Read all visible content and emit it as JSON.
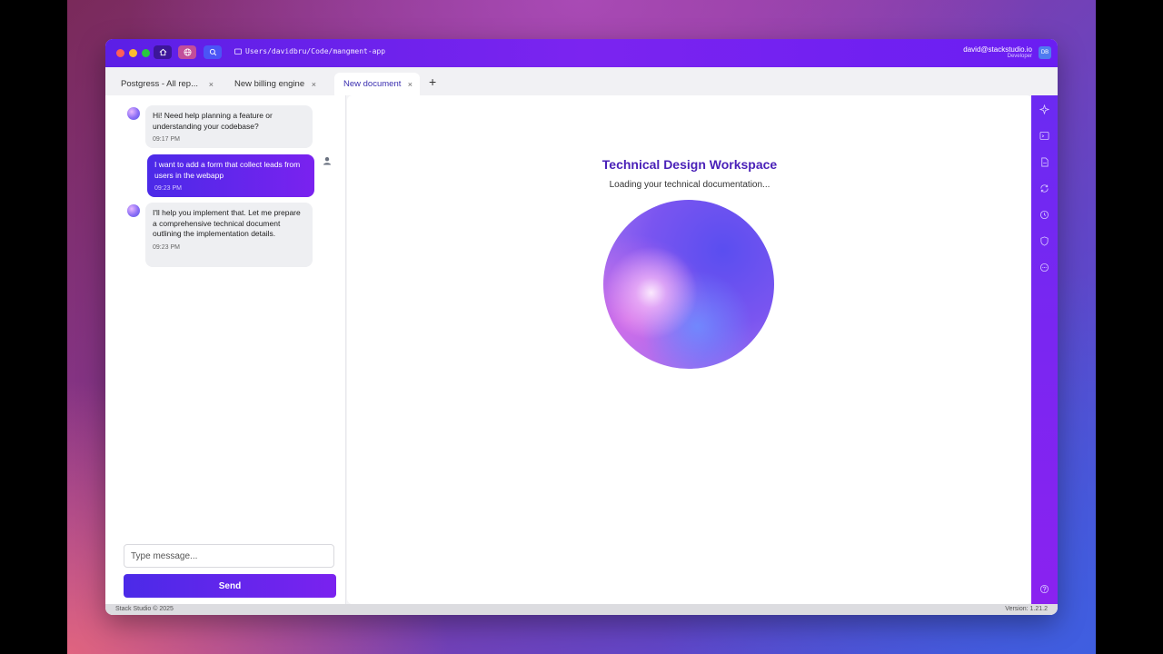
{
  "titlebar": {
    "path": "Users/davidbru/Code/mangment-app",
    "user_email": "david@stackstudio.io",
    "user_role": "Developer",
    "avatar_initials": "DB"
  },
  "tabs": [
    {
      "label": "Postgress - All rep...",
      "close": "×"
    },
    {
      "label": "New billing engine",
      "close": "×"
    },
    {
      "label": "New document",
      "close": "×"
    }
  ],
  "tab_add": "+",
  "chat": {
    "messages": [
      {
        "from": "bot",
        "text": "Hi! Need help planning a feature or understanding your codebase?",
        "time": "09:17 PM"
      },
      {
        "from": "user",
        "text": "I want to add a form that collect leads from users in the webapp",
        "time": "09:23 PM"
      },
      {
        "from": "bot",
        "text": "I'll help you implement that. Let me prepare a comprehensive technical document outlining the implementation details.",
        "time": "09:23 PM"
      }
    ],
    "input_placeholder": "Type message...",
    "send_label": "Send"
  },
  "document": {
    "title": "Technical Design Workspace",
    "subtitle": "Loading your technical documentation..."
  },
  "status": {
    "left": "Stack Studio © 2025",
    "right": "Version: 1.21.2"
  },
  "colors": {
    "accent": "#6b24f0",
    "title": "#4a21b8"
  },
  "icons": {
    "rightbar": [
      "sparkle-icon",
      "terminal-icon",
      "file-icon",
      "refresh-icon",
      "clock-icon",
      "shield-icon",
      "chat-icon",
      "help-icon"
    ]
  }
}
